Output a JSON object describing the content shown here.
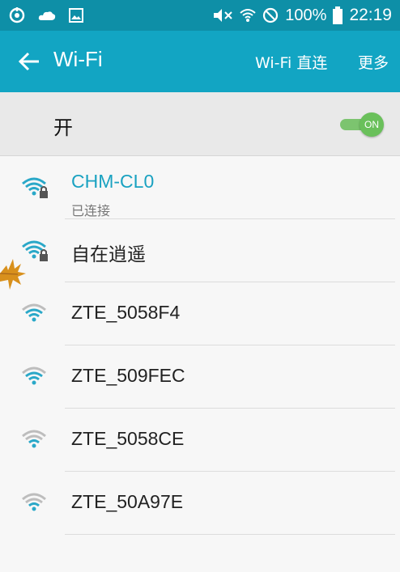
{
  "status_bar": {
    "battery_percent": "100%",
    "time": "22:19"
  },
  "app_bar": {
    "title": "Wi-Fi",
    "action_wifi_direct": "Wi-Fi 直连",
    "action_more": "更多"
  },
  "master_switch": {
    "label": "开",
    "state": "ON"
  },
  "networks": [
    {
      "ssid": "CHM-CL0",
      "status": "已连接",
      "secured": true,
      "signal": "strong"
    },
    {
      "ssid": "自在逍遥",
      "secured": true,
      "signal": "strong"
    },
    {
      "ssid": "ZTE_5058F4",
      "secured": false,
      "signal": "medium"
    },
    {
      "ssid": "ZTE_509FEC",
      "secured": false,
      "signal": "medium"
    },
    {
      "ssid": "ZTE_5058CE",
      "secured": false,
      "signal": "weak"
    },
    {
      "ssid": "ZTE_50A97E",
      "secured": false,
      "signal": "weak"
    }
  ],
  "colors": {
    "status_bar": "#0e8fa7",
    "app_bar": "#12a5c3",
    "connected_text": "#1aa2c1",
    "switch_on": "#6ac05b"
  }
}
